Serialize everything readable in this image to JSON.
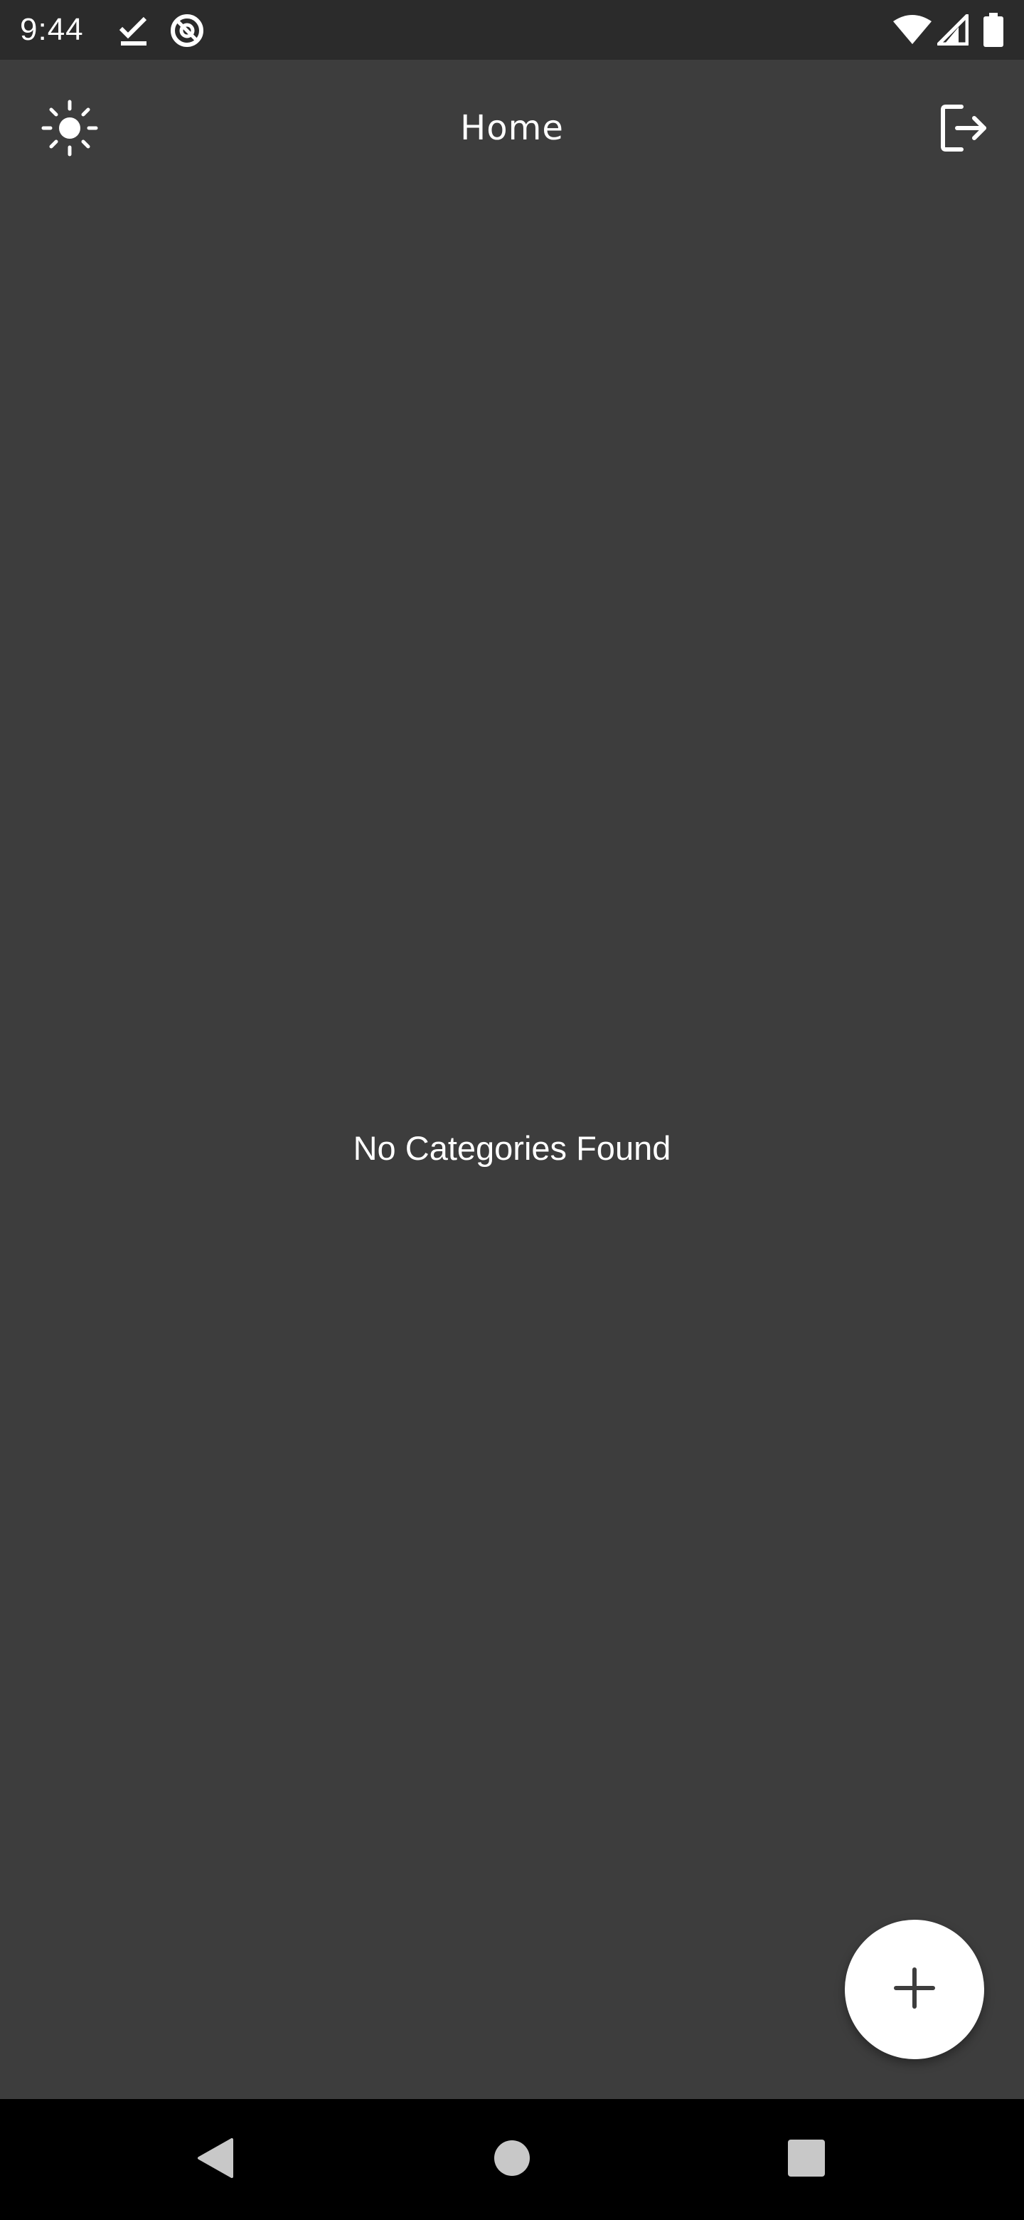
{
  "status_bar": {
    "time": "9:44",
    "icons": [
      "checkmark-download-icon",
      "no-disturb-icon",
      "wifi-icon",
      "cellular-signal-icon",
      "battery-icon"
    ]
  },
  "app_bar": {
    "title": "Home",
    "leading_icon": "sun-theme-icon",
    "trailing_icon": "logout-icon"
  },
  "content": {
    "empty_message": "No Categories Found"
  },
  "fab": {
    "icon": "plus-icon"
  },
  "nav_bar": {
    "buttons": [
      "back-icon",
      "home-icon",
      "recents-icon"
    ]
  },
  "colors": {
    "background": "#3d3d3d",
    "status_bar": "#2b2b2b",
    "nav_bar": "#000000",
    "text": "#ffffff",
    "fab": "#ffffff",
    "fab_icon": "#3d3d3d"
  }
}
